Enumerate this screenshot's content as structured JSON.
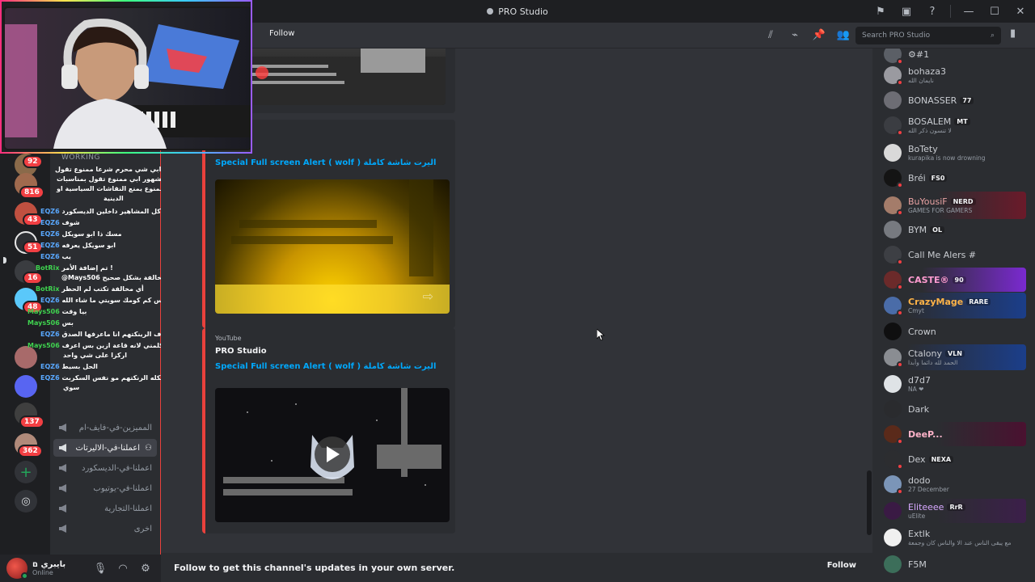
{
  "window": {
    "title": "PRO Studio"
  },
  "header": {
    "follow_label": "Follow",
    "search_placeholder": "Search PRO Studio"
  },
  "rail": {
    "badges": [
      "92",
      "816",
      "43",
      "51",
      "16",
      "48",
      "137",
      "362"
    ]
  },
  "channels": {
    "group_label": "WORKING",
    "items": [
      {
        "name": "المميزين-في-فايف-ام",
        "active": false
      },
      {
        "name": "اعملنا-في-الاليرتات",
        "active": true
      },
      {
        "name": "اعملنا-في-الديسكورد",
        "active": false
      },
      {
        "name": "اعملنا-في-يوتيوب",
        "active": false
      },
      {
        "name": "اعملنا-التجارية",
        "active": false
      },
      {
        "name": "اخرى",
        "active": false
      }
    ]
  },
  "stream_chat": [
    {
      "user": "",
      "text": "ابي شي محرم شرعا ممنوع تقول"
    },
    {
      "user": "",
      "text": "مشهور ابي ممنوع تقول بمناسبات"
    },
    {
      "user": "",
      "text": "ممنوع يمنع النقاشات السياسية او"
    },
    {
      "user": "",
      "text": "الدينية"
    },
    {
      "user": "EQZ6",
      "text": "اصلا كل المشاهير داخلين الديسكورد"
    },
    {
      "user": "EQZ6",
      "text": "شوف"
    },
    {
      "user": "EQZ6",
      "text": "مسك ذا ابو سويكل"
    },
    {
      "user": "EQZ6",
      "text": "ابو سويكل يعرفه"
    },
    {
      "user": "EQZ6",
      "text": "يب"
    },
    {
      "user": "BotRix",
      "text": "تم إضافة الأمر !"
    },
    {
      "user": "",
      "text": "@Mays506 مخالفة بشكل صحيح"
    },
    {
      "user": "BotRix",
      "text": "أي مخالفة تكتب لم الحظر"
    },
    {
      "user": "EQZ6",
      "text": "ميس كم كومك سويتي ما شاء الله"
    },
    {
      "user": "Mays506",
      "text": "بيا وقت"
    },
    {
      "user": "Mays506",
      "text": "بس"
    },
    {
      "user": "EQZ6",
      "text": "شوف الرينكتهم انا ماعرفها الصدق"
    },
    {
      "user": "Mays506",
      "text": "لحد يكلمني لانه قاعة ازين بس اعرف"
    },
    {
      "user": "",
      "text": "اركزا على شي واحد"
    },
    {
      "user": "EQZ6",
      "text": "الحل بسيط"
    },
    {
      "user": "EQZ6",
      "text": "مالك شكله الرنكتهم مو نفس السكربت"
    },
    {
      "user": "",
      "text": "سوي"
    }
  ],
  "user_panel": {
    "name": "بايبري ם",
    "status": "Online"
  },
  "messages": [
    {
      "provider": "",
      "author": "",
      "title": "Special Full screen Alert ( wolf ) اليرت شاشة كاملة"
    },
    {
      "provider": "YouTube",
      "author": "PRO Studio",
      "title": "Special Full screen Alert ( wolf ) اليرت شاشة كاملة"
    }
  ],
  "footer": {
    "text": "Follow to get this channel's updates in your own server.",
    "button": "Follow"
  },
  "members": [
    {
      "name": "⚙#1",
      "tag": "",
      "activity": "",
      "color": "#c9ccd1",
      "avatar": "#5b5f66"
    },
    {
      "name": "bohaza3",
      "tag": "",
      "activity": "نايمان الله",
      "color": "#c9ccd1",
      "avatar": "#9a9aa0"
    },
    {
      "name": "BONASSER",
      "tag": "77",
      "activity": "",
      "color": "#c9ccd1",
      "avatar": "#6d6d74"
    },
    {
      "name": "BOSALEM",
      "tag": "MT",
      "activity": "لا تنسون ذكر الله",
      "color": "#c9ccd1",
      "avatar": "#3b3d42"
    },
    {
      "name": "BoTety",
      "tag": "",
      "activity": "kurapika is now drowning",
      "color": "#c9ccd1",
      "avatar": "#d9d9d9"
    },
    {
      "name": "Bréi",
      "tag": "FS0",
      "activity": "",
      "color": "#c9ccd1",
      "avatar": "#141414"
    },
    {
      "name": "BuYousiF",
      "tag": "NERD",
      "activity": "GAMES FOR GAMERS",
      "color": "#e9a3a3",
      "avatar": "#a47c6a"
    },
    {
      "name": "BYM",
      "tag": "OL",
      "activity": "",
      "color": "#c9ccd1",
      "avatar": "#777a80"
    },
    {
      "name": "Call Me Alers #",
      "tag": "",
      "activity": "",
      "color": "#c9ccd1",
      "avatar": "#3d3f44"
    },
    {
      "name": "CASTE®",
      "tag": "90",
      "activity": "",
      "color": "#ff9bd0",
      "avatar": "#6b2a2a"
    },
    {
      "name": "CrazyMage",
      "tag": "RARE",
      "activity": "Cmyt",
      "color": "#ffb347",
      "avatar": "#4a6ca8"
    },
    {
      "name": "Crown",
      "tag": "",
      "activity": "",
      "color": "#c9ccd1",
      "avatar": "#0f0f10"
    },
    {
      "name": "Ctalony",
      "tag": "VLN",
      "activity": "الحمد لله دائما وأبدا",
      "color": "#c9ccd1",
      "avatar": "#8a8d92"
    },
    {
      "name": "d7d7",
      "tag": "",
      "activity": "NA ❤",
      "color": "#c9ccd1",
      "avatar": "#dfe3e6"
    },
    {
      "name": "Dark",
      "tag": "",
      "activity": "",
      "color": "#c9ccd1",
      "avatar": "#2a2b2e"
    },
    {
      "name": "DeeP...",
      "tag": "",
      "activity": "",
      "color": "#ffb3c9",
      "avatar": "#5a2a1a"
    },
    {
      "name": "Dex",
      "tag": "NEXA",
      "activity": "",
      "color": "#c9ccd1",
      "avatar": "#2c2d30"
    },
    {
      "name": "dodo",
      "tag": "",
      "activity": "27 December",
      "color": "#c9ccd1",
      "avatar": "#7b95b8"
    },
    {
      "name": "Eliteeee",
      "tag": "RrR",
      "activity": "uElite",
      "color": "#d7a8ff",
      "avatar": "#3a1a44"
    },
    {
      "name": "Extlk",
      "tag": "",
      "activity": "مع يبقى الناس عند الا والناس كان وجمعة",
      "color": "#c9ccd1",
      "avatar": "#f0f0f0"
    },
    {
      "name": "F5M",
      "tag": "",
      "activity": "",
      "color": "#c9ccd1",
      "avatar": "#3c6e5a"
    }
  ]
}
